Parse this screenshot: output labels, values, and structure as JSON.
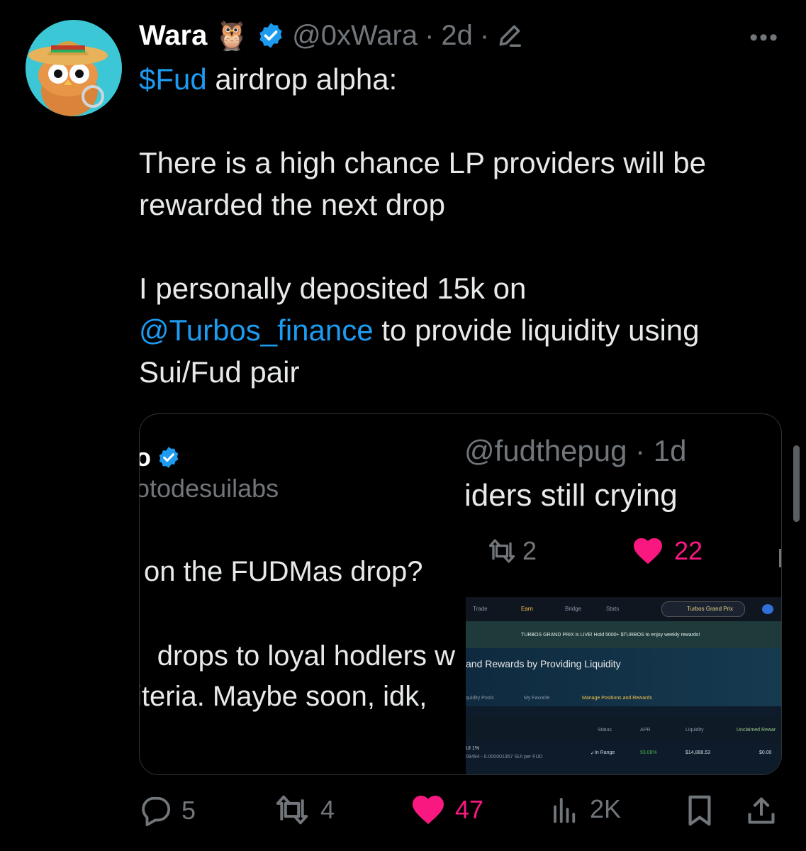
{
  "author": {
    "name": "Wara",
    "emoji": "🦉",
    "handle": "@0xWara",
    "time": "2d"
  },
  "tweet": {
    "cashtag": "$Fud",
    "line1_rest": " airdrop alpha:",
    "para2": "There is a high chance LP providers will be rewarded the next drop",
    "para3_start": "I personally deposited 15k on",
    "mention": "@Turbos_finance",
    "para3_mid": " to provide liquidity using",
    "para3_end": "Sui/Fud pair"
  },
  "quote": {
    "name_fragment": "o",
    "handle_fragment": "otodesuilabs",
    "handle2": "@fudthepug · 1d",
    "line2": "iders still crying",
    "retweets": "2",
    "likes": "22",
    "text1": "on the FUDMas drop?",
    "text2": "drops to loyal hodlers w",
    "text3": "iteria. Maybe soon, idk,"
  },
  "screenshot": {
    "nav": [
      "Trade",
      "Earn",
      "Bridge",
      "Stats",
      "Turbos Grand Prix"
    ],
    "banner": "TURBOS GRAND PRIX is LIVE! Hold 5000+ $TURBOS to enjoy weekly rewards!",
    "hero_title": "and Rewards by Providing Liquidity",
    "tabs": [
      "quidity Pools",
      "My Favorite",
      "Manage Positions and Rewards"
    ],
    "columns": [
      "Status",
      "APR",
      "Liquidity",
      "Unclaimed Rewar"
    ],
    "row": {
      "pair": "UI  1%",
      "range": "09494 - 0.000001357 SUI per FUD",
      "status": "In Range",
      "apr": "93.08%",
      "liquidity": "$14,888.53",
      "unclaimed": "$0.00"
    }
  },
  "actions": {
    "replies": "5",
    "retweets": "4",
    "likes": "47",
    "views": "2K"
  },
  "colors": {
    "background": "#000000",
    "link": "#1d9bf0",
    "like": "#f91880",
    "muted": "#71767b",
    "verified": "#1d9bf0"
  }
}
